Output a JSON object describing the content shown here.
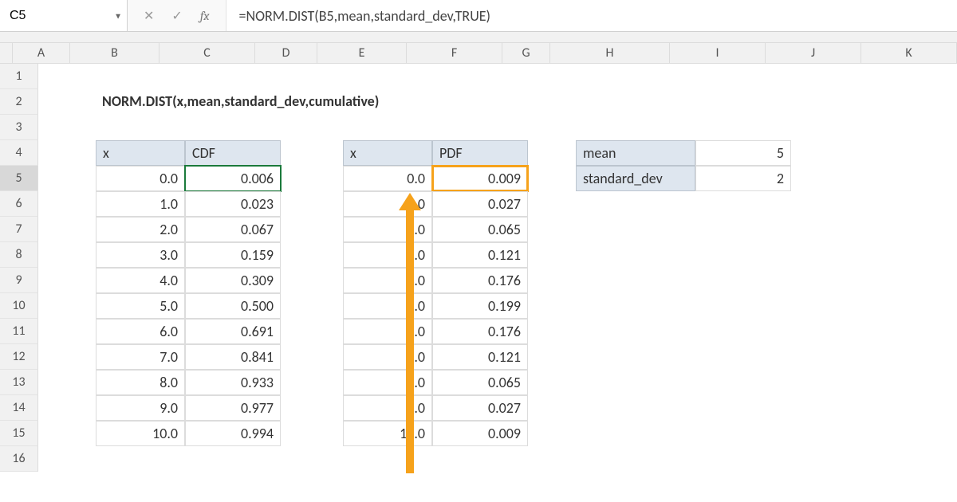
{
  "active_cell": "C5",
  "formula": "=NORM.DIST(B5,mean,standard_dev,TRUE)",
  "title_text": "NORM.DIST(x,mean,standard_dev,cumulative)",
  "columns": [
    "A",
    "B",
    "C",
    "D",
    "E",
    "F",
    "G",
    "H",
    "I",
    "J",
    "K"
  ],
  "rows": [
    "1",
    "2",
    "3",
    "4",
    "5",
    "6",
    "7",
    "8",
    "9",
    "10",
    "11",
    "12",
    "13",
    "14",
    "15",
    "16"
  ],
  "headers": {
    "x1": "x",
    "cdf": "CDF",
    "x2": "x",
    "pdf": "PDF",
    "mean": "mean",
    "sdev": "standard_dev"
  },
  "params": {
    "mean": "5",
    "sdev": "2"
  },
  "table1": [
    {
      "x": "0.0",
      "v": "0.006"
    },
    {
      "x": "1.0",
      "v": "0.023"
    },
    {
      "x": "2.0",
      "v": "0.067"
    },
    {
      "x": "3.0",
      "v": "0.159"
    },
    {
      "x": "4.0",
      "v": "0.309"
    },
    {
      "x": "5.0",
      "v": "0.500"
    },
    {
      "x": "6.0",
      "v": "0.691"
    },
    {
      "x": "7.0",
      "v": "0.841"
    },
    {
      "x": "8.0",
      "v": "0.933"
    },
    {
      "x": "9.0",
      "v": "0.977"
    },
    {
      "x": "10.0",
      "v": "0.994"
    }
  ],
  "table2": [
    {
      "x": "0.0",
      "v": "0.009"
    },
    {
      "x": "1.0",
      "v": "0.027"
    },
    {
      "x": "2.0",
      "v": "0.065"
    },
    {
      "x": "3.0",
      "v": "0.121"
    },
    {
      "x": "4.0",
      "v": "0.176"
    },
    {
      "x": "5.0",
      "v": "0.199"
    },
    {
      "x": "6.0",
      "v": "0.176"
    },
    {
      "x": "7.0",
      "v": "0.121"
    },
    {
      "x": "8.0",
      "v": "0.065"
    },
    {
      "x": "9.0",
      "v": "0.027"
    },
    {
      "x": "10.0",
      "v": "0.009"
    }
  ],
  "icons": {
    "fx": "fx"
  }
}
